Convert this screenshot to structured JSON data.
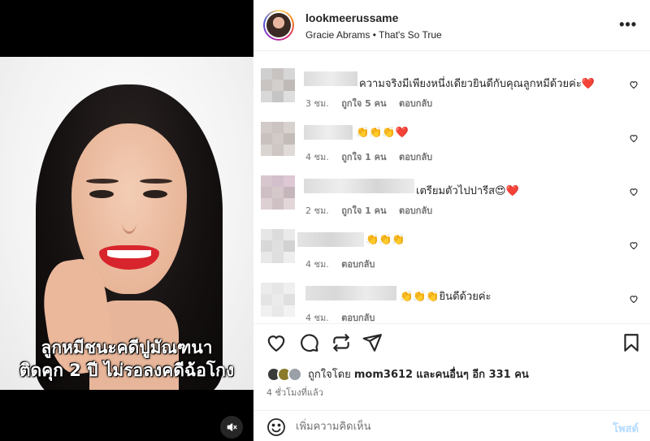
{
  "media": {
    "caption_line1": "ลูกหมีชนะคดีปูมัณฑนา",
    "caption_line2": "ติดคุก 2 ปี ไม่รอลงคดีฉ้อโกง",
    "mute_icon": "speaker-muted-icon"
  },
  "header": {
    "username": "lookmeerussame",
    "song": "Gracie Abrams • That's So True",
    "more_icon": "more-horizontal-icon"
  },
  "comments": [
    {
      "text": "ความจริงมีเพียงหนึ่งเดียวยินดีกับคุณลูกหมีด้วยค่ะ❤️",
      "time": "3 ชม.",
      "likes": "ถูกใจ 5 คน",
      "reply": "ตอบกลับ"
    },
    {
      "text": "👏👏👏❤️",
      "time": "4 ชม.",
      "likes": "ถูกใจ 1 คน",
      "reply": "ตอบกลับ"
    },
    {
      "text": "เตรียมตัวไปปารีส😍❤️",
      "time": "2 ชม.",
      "likes": "ถูกใจ 1 คน",
      "reply": "ตอบกลับ"
    },
    {
      "text": "👏👏👏",
      "time": "4 ชม.",
      "likes": "",
      "reply": "ตอบกลับ"
    },
    {
      "text": "👏👏👏ยินดีด้วยค่ะ",
      "time": "4 ชม.",
      "likes": "",
      "reply": "ตอบกลับ"
    }
  ],
  "likes": {
    "prefix": "ถูกใจโดย",
    "user": "mom3612",
    "suffix": "และคนอื่นๆ อีก 331 คน"
  },
  "time_ago": "4 ชั่วโมงที่แล้ว",
  "add_comment": {
    "placeholder": "เพิ่มความคิดเห็น",
    "post_label": "โพสต์"
  },
  "colors": {
    "accent_heart": "#ed4956",
    "post_button": "#b3dbff",
    "meta_gray": "#737373"
  }
}
